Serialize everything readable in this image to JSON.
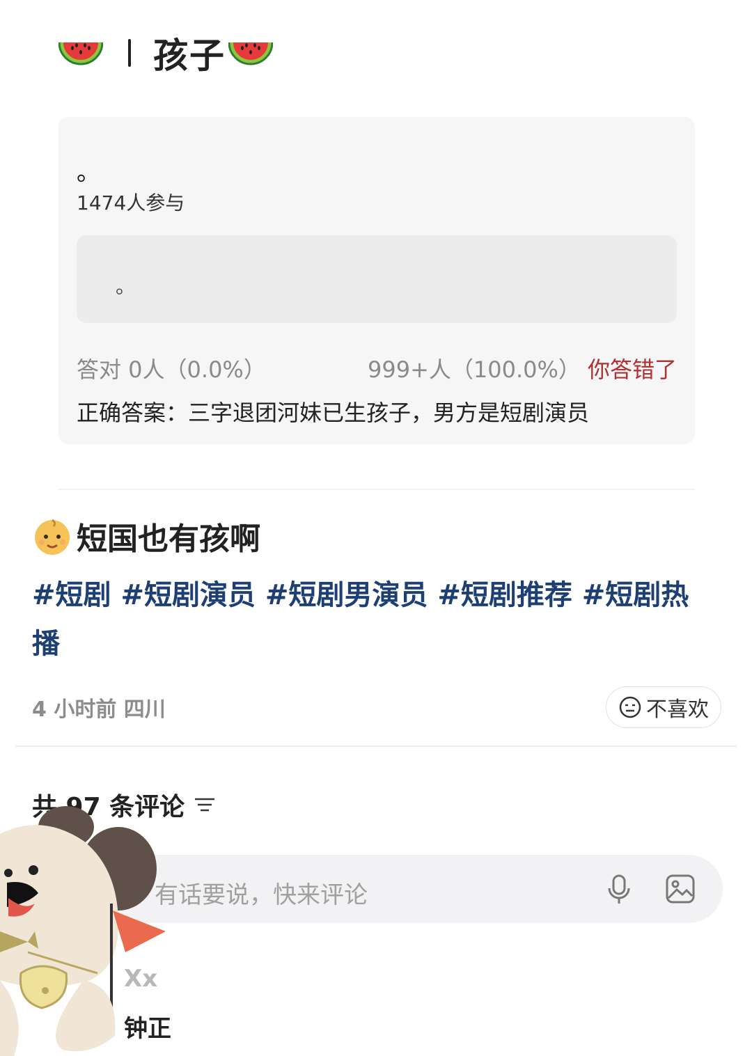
{
  "header": {
    "title": "孩子"
  },
  "quiz": {
    "question": "。",
    "participants": "1474人参与",
    "option_text": "。",
    "correct_stat": "答对  0人（0.0%）",
    "wrong_stat": "999+人（100.0%）",
    "result": "你答错了",
    "answer": "正确答案：三字退团河妹已生孩子，男方是短剧演员"
  },
  "post": {
    "title": "短国也有孩啊",
    "tags_line1": "#短剧 #短剧演员 #短剧男演员 #短剧推荐 #短剧热",
    "tags_line2": "播",
    "meta": "4 小时前 四川",
    "dislike_label": "不喜欢"
  },
  "comments": {
    "count_label": "共 97 条评论",
    "placeholder": "有话要说，快来评论",
    "first_user_mark": "Xx",
    "first_user_name": "钟正"
  },
  "colors": {
    "tag_blue": "#1d3f73",
    "wrong_red": "#b2302f"
  },
  "icons": [
    "watermelon-icon",
    "baby-emoji-icon",
    "dislike-face-icon",
    "sort-icon",
    "microphone-icon",
    "image-icon"
  ]
}
